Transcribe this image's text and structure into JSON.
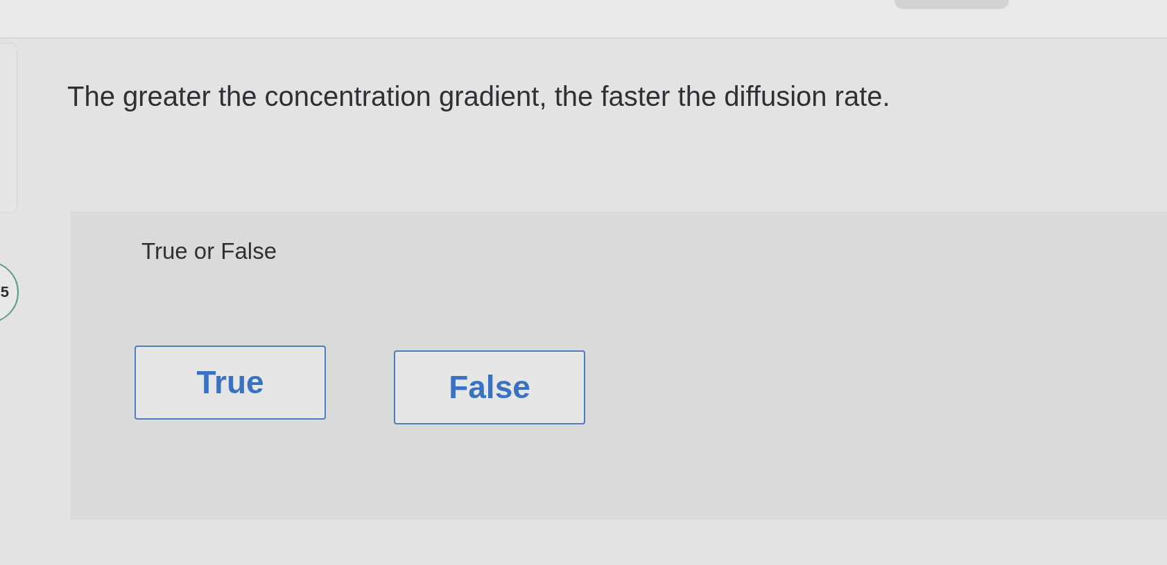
{
  "question_number": {
    "label": "5"
  },
  "question": {
    "text": "The greater the concentration gradient, the faster the diffusion rate."
  },
  "answer_panel": {
    "prompt": "True or False",
    "options": [
      {
        "label": "True"
      },
      {
        "label": "False"
      }
    ]
  }
}
